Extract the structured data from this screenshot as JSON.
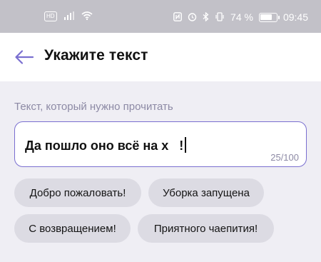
{
  "status_bar": {
    "carrier_badge": "HD",
    "battery_text": "74 %",
    "battery_level": 0.74,
    "time": "09:45",
    "icons": [
      "hd-icon",
      "signal-icon",
      "wifi-icon",
      "nfc-icon",
      "alarm-icon",
      "bluetooth-icon",
      "vibrate-icon",
      "battery-icon"
    ]
  },
  "header": {
    "title": "Укажите текст",
    "back_icon": "arrow-left-icon"
  },
  "form": {
    "label": "Текст, который нужно прочитать",
    "value": "Да пошло оно всё на х   !",
    "counter": "25/100"
  },
  "suggestions": [
    {
      "label": "Добро пожаловать!"
    },
    {
      "label": "Уборка запущена"
    },
    {
      "label": "С возвращением!"
    },
    {
      "label": "Приятного чаепития!"
    }
  ],
  "colors": {
    "accent": "#7a6fd0",
    "muted_text": "#8d8aa5",
    "chip_bg": "#dcdbe3",
    "page_bg": "#efeef4",
    "status_bar_bg": "#c2c1c8"
  }
}
